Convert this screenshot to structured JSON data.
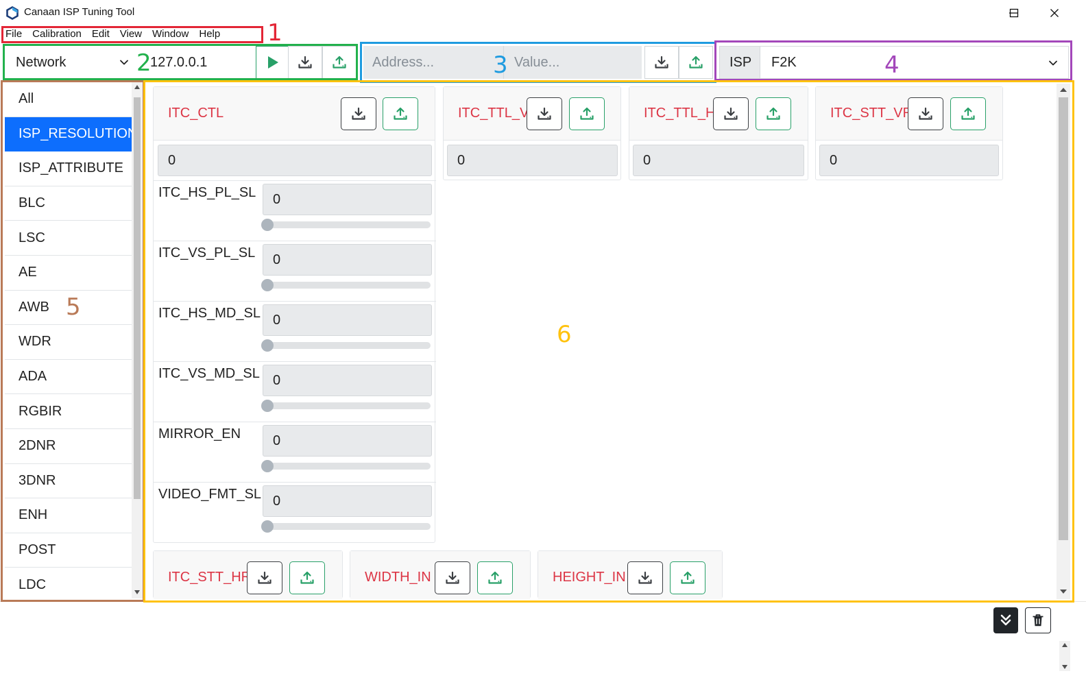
{
  "window": {
    "title": "Canaan ISP Tuning Tool",
    "minimize_icon": "minimize-icon",
    "maximize_icon": "maximize-icon",
    "close_icon": "close-icon"
  },
  "menu": [
    "File",
    "Calibration",
    "Edit",
    "View",
    "Window",
    "Help"
  ],
  "connection": {
    "mode": "Network",
    "ip": "127.0.0.1"
  },
  "register": {
    "address_placeholder": "Address...",
    "value_placeholder": "Value..."
  },
  "device": {
    "label": "ISP",
    "selected": "F2K"
  },
  "sidebar": {
    "items": [
      "All",
      "ISP_RESOLUTION",
      "ISP_ATTRIBUTE",
      "BLC",
      "LSC",
      "AE",
      "AWB",
      "WDR",
      "ADA",
      "RGBIR",
      "2DNR",
      "3DNR",
      "ENH",
      "POST",
      "LDC"
    ],
    "active": "ISP_RESOLUTION"
  },
  "cards": {
    "itc_ctl": {
      "title": "ITC_CTL",
      "value": "0",
      "fields": [
        {
          "label": "ITC_HS_PL_SL",
          "value": "0"
        },
        {
          "label": "ITC_VS_PL_SL",
          "value": "0"
        },
        {
          "label": "ITC_HS_MD_SL",
          "value": "0"
        },
        {
          "label": "ITC_VS_MD_SL",
          "value": "0"
        },
        {
          "label": "MIRROR_EN",
          "value": "0"
        },
        {
          "label": "VIDEO_FMT_SL",
          "value": "0"
        }
      ]
    },
    "itc_ttl_v": {
      "title": "ITC_TTL_V",
      "value": "0"
    },
    "itc_ttl_h": {
      "title": "ITC_TTL_H",
      "value": "0"
    },
    "itc_stt_vr": {
      "title": "ITC_STT_VR",
      "value": "0"
    },
    "itc_stt_hr": {
      "title": "ITC_STT_HR"
    },
    "width_in": {
      "title": "WIDTH_IN"
    },
    "height_in": {
      "title": "HEIGHT_IN"
    }
  },
  "annotations": [
    "1",
    "2",
    "3",
    "4",
    "5",
    "6"
  ],
  "colors": {
    "accent": "#0d6efd",
    "register_title": "#dc3545",
    "upload_icon": "#28a068",
    "anno_1": "#e32636",
    "anno_2": "#22b14c",
    "anno_3": "#1e9be0",
    "anno_4": "#a347ba",
    "anno_5": "#b97a57",
    "anno_6": "#ffc20e"
  }
}
